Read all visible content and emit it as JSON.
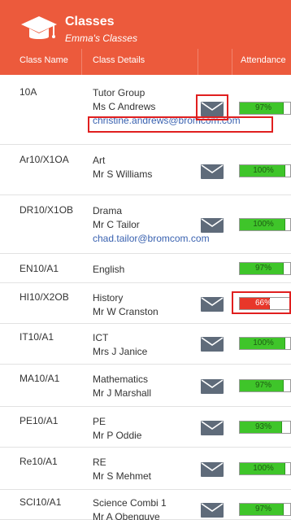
{
  "header": {
    "title": "Classes",
    "subtitle": "Emma's Classes",
    "icon": "graduation-cap-icon",
    "columns": [
      "Class Name",
      "Class Details",
      "Attendance"
    ]
  },
  "colors": {
    "header_bg": "#ec5a3c",
    "attendance_ok": "#3fc52a",
    "attendance_low": "#e8372a",
    "email_link": "#3a62b0",
    "highlight": "#e01f1f"
  },
  "rows": [
    {
      "class": "10A",
      "subject": "Tutor Group",
      "teacher": "Ms C Andrews",
      "email": "christine.andrews@bromcom.com",
      "attendance": "97%",
      "attendance_value": 97
    },
    {
      "class": "Ar10/X1OA",
      "subject": "Art",
      "teacher": "Mr S Williams",
      "email": "",
      "attendance": "100%",
      "attendance_value": 100
    },
    {
      "class": "DR10/X1OB",
      "subject": "Drama",
      "teacher": "Mr C Tailor",
      "email": "chad.tailor@bromcom.com",
      "attendance": "100%",
      "attendance_value": 100
    },
    {
      "class": "EN10/A1",
      "subject": "English",
      "teacher": "",
      "email": "",
      "attendance": "97%",
      "attendance_value": 97
    },
    {
      "class": "HI10/X2OB",
      "subject": "History",
      "teacher": "Mr W Cranston",
      "email": "",
      "attendance": "66%",
      "attendance_value": 66
    },
    {
      "class": "IT10/A1",
      "subject": "ICT",
      "teacher": "Mrs J Janice",
      "email": "",
      "attendance": "100%",
      "attendance_value": 100
    },
    {
      "class": "MA10/A1",
      "subject": "Mathematics",
      "teacher": "Mr J Marshall",
      "email": "",
      "attendance": "97%",
      "attendance_value": 97
    },
    {
      "class": "PE10/A1",
      "subject": "PE",
      "teacher": "Mr P Oddie",
      "email": "",
      "attendance": "93%",
      "attendance_value": 93
    },
    {
      "class": "Re10/A1",
      "subject": "RE",
      "teacher": "Mr S Mehmet",
      "email": "",
      "attendance": "100%",
      "attendance_value": 100
    },
    {
      "class": "SCI10/A1",
      "subject": "Science Combi 1",
      "teacher": "Mr A Obenguye",
      "email": "",
      "attendance": "97%",
      "attendance_value": 97
    }
  ]
}
